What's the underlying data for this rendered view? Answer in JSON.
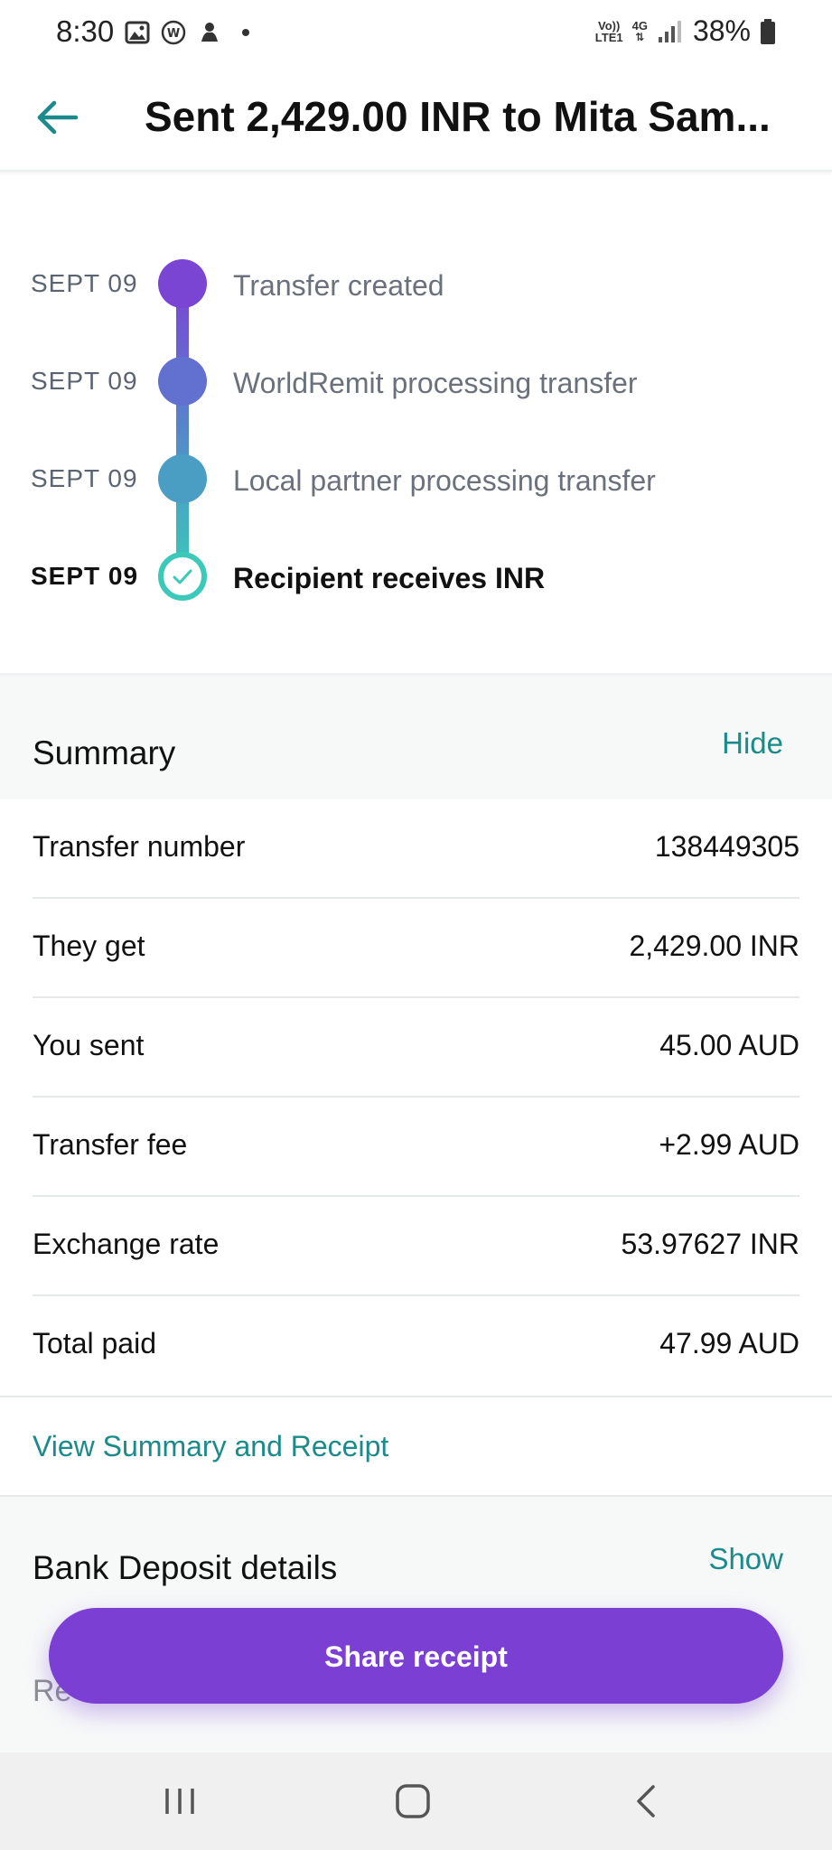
{
  "status_bar": {
    "time": "8:30",
    "network_top": "Vo))",
    "network_bottom": "LTE1",
    "network_type": "4G",
    "battery": "38%",
    "icons": [
      "gallery-icon",
      "w-app-icon",
      "notification-icon",
      "dot-icon",
      "signal-icon",
      "battery-icon"
    ]
  },
  "header": {
    "title": "Sent 2,429.00 INR to Mita Sam..."
  },
  "timeline": [
    {
      "date": "SEPT 09",
      "label": "Transfer created",
      "color": "#7a45d3"
    },
    {
      "date": "SEPT 09",
      "label": "WorldRemit processing transfer",
      "color": "#6270d0"
    },
    {
      "date": "SEPT 09",
      "label": "Local partner processing transfer",
      "color": "#4a9ec3"
    },
    {
      "date": "SEPT 09",
      "label": "Recipient receives INR",
      "color": "#3cc9b9"
    }
  ],
  "summary": {
    "title": "Summary",
    "toggle": "Hide",
    "rows": [
      {
        "label": "Transfer number",
        "value": "138449305"
      },
      {
        "label": "They get",
        "value": "2,429.00 INR"
      },
      {
        "label": "You sent",
        "value": "45.00 AUD"
      },
      {
        "label": "Transfer fee",
        "value": "+2.99 AUD"
      },
      {
        "label": "Exchange rate",
        "value": "53.97627 INR"
      },
      {
        "label": "Total paid",
        "value": "47.99 AUD"
      }
    ],
    "receipt_link": "View Summary and Receipt"
  },
  "bank_deposit": {
    "title": "Bank Deposit details",
    "toggle": "Show",
    "partial_text": "Re"
  },
  "share_button": "Share receipt",
  "colors": {
    "accent_teal": "#1a8a8a",
    "primary_purple": "#7b3fd4"
  }
}
